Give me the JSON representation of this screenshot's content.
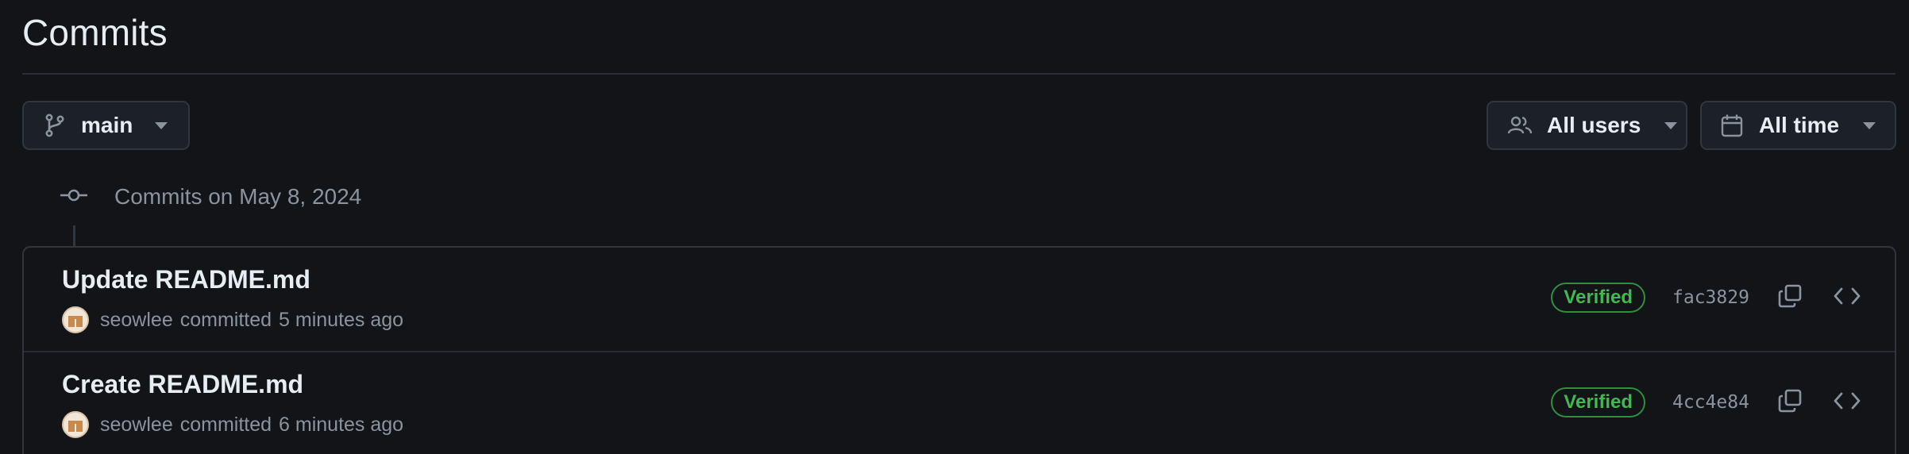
{
  "page": {
    "title": "Commits"
  },
  "toolbar": {
    "branch_label": "main",
    "users_label": "All users",
    "time_label": "All time"
  },
  "group": {
    "label": "Commits on May 8, 2024"
  },
  "commits": [
    {
      "message": "Update README.md",
      "author": "seowlee",
      "verb": "committed",
      "time": "5 minutes ago",
      "badge": "Verified",
      "sha": "fac3829"
    },
    {
      "message": "Create README.md",
      "author": "seowlee",
      "verb": "committed",
      "time": "6 minutes ago",
      "badge": "Verified",
      "sha": "4cc4e84"
    }
  ],
  "icons": {
    "branch": "git-branch-icon",
    "users": "people-icon",
    "calendar": "calendar-icon",
    "commit": "git-commit-icon",
    "copy": "copy-icon",
    "browse": "code-icon",
    "caret": "caret-down-icon"
  },
  "colors": {
    "background": "#121418",
    "border": "#30363d",
    "text": "#e6edf3",
    "muted": "#8b949e",
    "verified": "#3fb950"
  }
}
